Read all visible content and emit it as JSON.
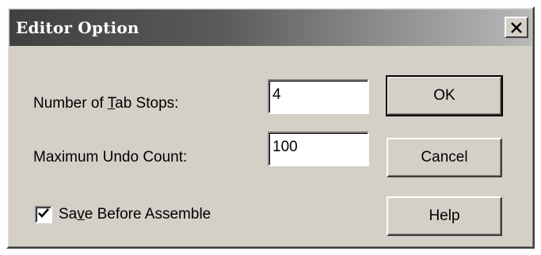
{
  "window": {
    "title": "Editor Option",
    "close_icon": "close-icon"
  },
  "fields": {
    "tab_stops": {
      "label_before": "Number of ",
      "label_mnemonic": "T",
      "label_after": "ab Stops:",
      "value": "4"
    },
    "undo_count": {
      "label": "Maximum Undo Count:",
      "value": "100"
    }
  },
  "checkbox": {
    "label_before": "Sa",
    "label_mnemonic": "v",
    "label_after": "e Before Assemble",
    "checked": true
  },
  "buttons": {
    "ok": "OK",
    "cancel": "Cancel",
    "help": "Help"
  }
}
